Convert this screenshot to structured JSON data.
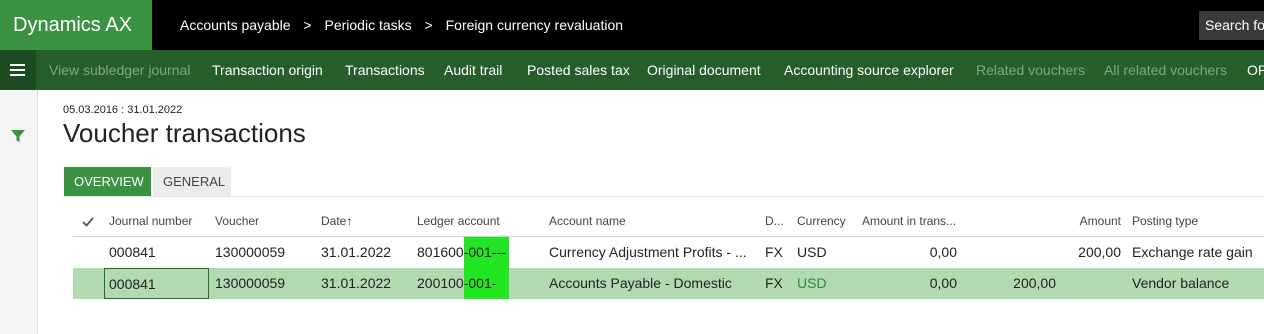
{
  "app": {
    "brand": "Dynamics AX"
  },
  "breadcrumb": [
    "Accounts payable",
    "Periodic tasks",
    "Foreign currency revaluation"
  ],
  "search": {
    "placeholder": "Search for"
  },
  "actions": [
    {
      "label": "View subledger journal",
      "enabled": false
    },
    {
      "label": "Transaction origin",
      "enabled": true
    },
    {
      "label": "Transactions",
      "enabled": true
    },
    {
      "label": "Audit trail",
      "enabled": true
    },
    {
      "label": "Posted sales tax",
      "enabled": true
    },
    {
      "label": "Original document",
      "enabled": true
    },
    {
      "label": "Accounting source explorer",
      "enabled": true
    },
    {
      "label": "Related vouchers",
      "enabled": false
    },
    {
      "label": "All related vouchers",
      "enabled": false
    },
    {
      "label": "OP",
      "enabled": true
    }
  ],
  "page": {
    "date_range": "05.03.2016 : 31.01.2022",
    "title": "Voucher transactions"
  },
  "tabs": [
    "OVERVIEW",
    "GENERAL"
  ],
  "grid": {
    "columns": [
      "Journal number",
      "Voucher",
      "Date",
      "Ledger account",
      "Account name",
      "D...",
      "Currency",
      "Amount in trans...",
      "Amount",
      "Posting type"
    ],
    "sort_arrow": "↑",
    "rows": [
      {
        "journal": "000841",
        "voucher": "130000059",
        "date": "31.01.2022",
        "ledger_main": "801600",
        "ledger_dims": "-001---",
        "account_name": "Currency Adjustment Profits - ...",
        "d": "FX",
        "currency": "USD",
        "amount_trans": "0,00",
        "amount_extra": "",
        "amount": "200,00",
        "posting_type": "Exchange rate gain"
      },
      {
        "journal": "000841",
        "voucher": "130000059",
        "date": "31.01.2022",
        "ledger_main": "200100",
        "ledger_dims": "-001-",
        "account_name": "Accounts Payable - Domestic",
        "d": "FX",
        "currency": "USD",
        "amount_trans": "0,00",
        "amount_extra": "200,00",
        "amount": "",
        "posting_type": "Vendor balance"
      }
    ]
  },
  "colors": {
    "brand": "#3b9243",
    "actionbar": "#255e2b",
    "selected_row": "#b3d9b3",
    "highlight": "#22e622"
  }
}
